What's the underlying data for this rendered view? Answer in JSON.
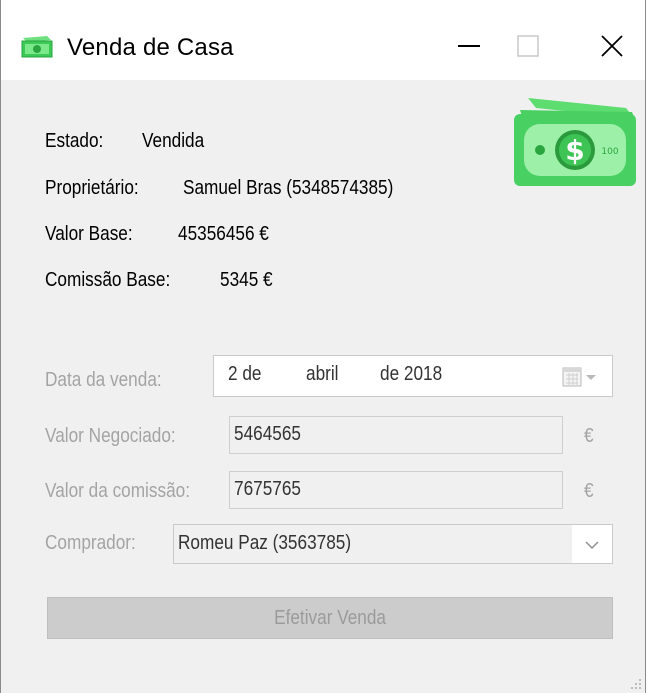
{
  "window": {
    "title": "Venda de Casa",
    "icons": {
      "app": "money-icon",
      "minimize": "minimize-icon",
      "maximize": "maximize-icon",
      "close": "close-icon"
    }
  },
  "info": {
    "estado_label": "Estado:",
    "estado_value": "Vendida",
    "proprietario_label": "Proprietário:",
    "proprietario_value": "Samuel Bras (5348574385)",
    "valor_base_label": "Valor Base:",
    "valor_base_value": "45356456 €",
    "comissao_base_label": "Comissão Base:",
    "comissao_base_value": "5345 €"
  },
  "form": {
    "data_label": "Data da venda:",
    "date": {
      "day": "2 de",
      "month": "abril",
      "year": "de 2018"
    },
    "valor_negociado_label": "Valor Negociado:",
    "valor_negociado_value": "5464565",
    "valor_negociado_unit": "€",
    "valor_comissao_label": "Valor da comissão:",
    "valor_comissao_value": "7675765",
    "valor_comissao_unit": "€",
    "comprador_label": "Comprador:",
    "comprador_value": "Romeu Paz (3563785)"
  },
  "actions": {
    "efetivar_label": "Efetivar Venda"
  },
  "colors": {
    "money_green": "#4cd964",
    "disabled_text": "#a4a4a4",
    "button_bg": "#cccccc"
  }
}
